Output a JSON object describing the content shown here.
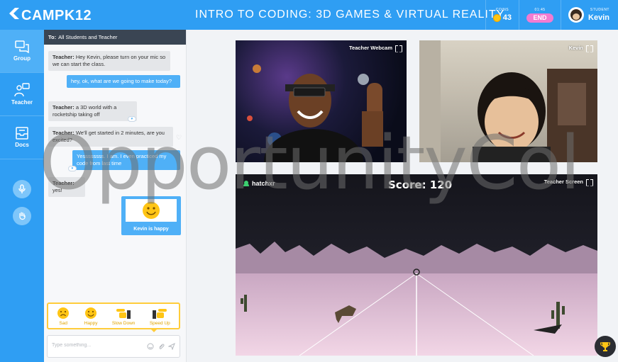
{
  "header": {
    "logo": "CAMPK12",
    "course_title": "INTRO TO CODING: 3D GAMES & VIRTUAL REALITY",
    "coins_label": "COINS",
    "coins_value": "43",
    "timer_label": "01:45",
    "end_label": "END",
    "student_label": "STUDENT",
    "student_name": "Kevin"
  },
  "sidebar": {
    "items": [
      {
        "label": "Group",
        "icon": "chat-group-icon"
      },
      {
        "label": "Teacher",
        "icon": "teacher-chat-icon"
      },
      {
        "label": "Docs",
        "icon": "inbox-docs-icon"
      }
    ]
  },
  "chat": {
    "header_prefix": "To:",
    "header_recipients": "All Students and Teacher",
    "messages": [
      {
        "from": "Teacher:",
        "text": "Hey Kevin, please turn on your mic so we can start the class."
      },
      {
        "from": "",
        "text": "hey, ok, what are we going to make today?"
      },
      {
        "from": "Teacher:",
        "text": "a 3D world with a rocketship taking off"
      },
      {
        "from": "Teacher:",
        "text": "We'll get started in 2 minutes, are you excited?"
      },
      {
        "from": "",
        "text": "Yessssssss. I am. I even practiced my code from last time"
      },
      {
        "from": "Teacher:",
        "text": "yes!"
      }
    ],
    "happy_caption": "Kevin is happy",
    "reactions": [
      {
        "label": "Sad"
      },
      {
        "label": "Happy"
      },
      {
        "label": "Slow Down"
      },
      {
        "label": "Speed Up"
      }
    ],
    "input_placeholder": "Type something..."
  },
  "videos": {
    "teacher_label": "Teacher Webcam",
    "student_label": "Kevin",
    "screen_label": "Teacher Screen",
    "app_name": "hatchxr",
    "score_text": "Score: 120"
  },
  "watermark": "OpportunityCol",
  "colors": {
    "primary": "#2f9ef3",
    "accent_pink": "#f27bd1",
    "coin": "#ffc515",
    "reaction": "#ffcc3a"
  }
}
